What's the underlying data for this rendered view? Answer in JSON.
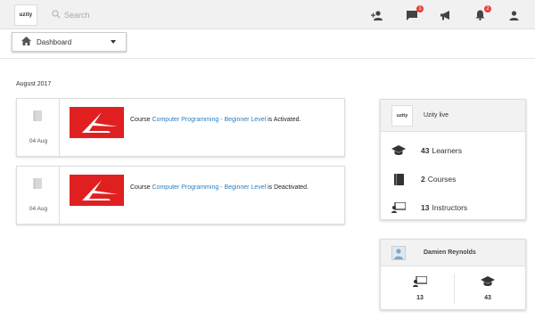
{
  "header": {
    "logo_text": "uzity",
    "search_placeholder": "Search",
    "messages_badge": "1",
    "notifications_badge": "2"
  },
  "dropdown": {
    "label": "Dashboard"
  },
  "feed": {
    "month": "August 2017",
    "items": [
      {
        "date": "04 Aug",
        "prefix": "Course",
        "course": "Computer Programming - Beginner Level",
        "suffix": "is Activated."
      },
      {
        "date": "04 Aug",
        "prefix": "Course",
        "course": "Computer Programming - Beginner Level",
        "suffix": "is Deactivated."
      }
    ]
  },
  "live_panel": {
    "logo_text": "uzity",
    "title": "Uzity live",
    "stats": [
      {
        "icon": "graduation-cap-icon",
        "count": "43",
        "label": "Learners"
      },
      {
        "icon": "book-icon",
        "count": "2",
        "label": "Courses"
      },
      {
        "icon": "presenter-icon",
        "count": "13",
        "label": "Instructors"
      }
    ]
  },
  "user_panel": {
    "name": "Damien Reynolds",
    "instructors_count": "13",
    "learners_count": "43"
  },
  "colors": {
    "accent_link": "#2a7fc1",
    "badge": "#e5413a",
    "thumb": "#e02020"
  }
}
